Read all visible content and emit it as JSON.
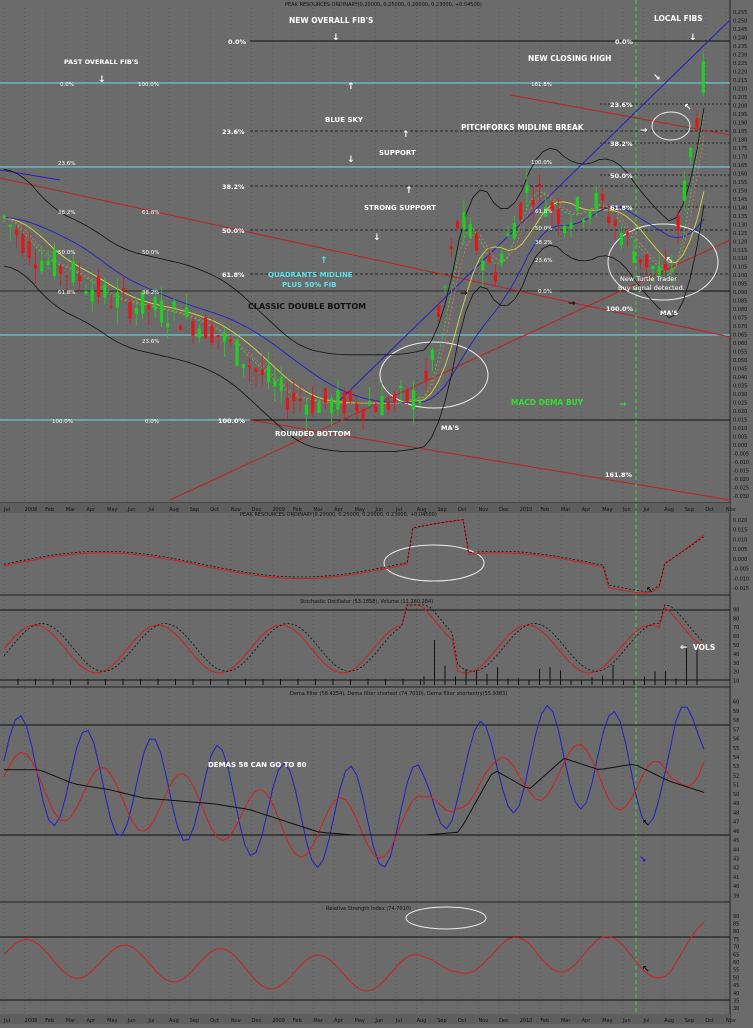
{
  "main_header": "PEAK RESOURCES ORDINARY(0.20000, 0.25000, 0.20000, 0.23000, +0.04500)",
  "panel_headers": {
    "macd": "PEAK RESOURCES ORDINARY(0.20000, 0.25000, 0.20000, 0.23000, +0.04500)",
    "stochastic": "Stochastic Oscillator (53.1858), Volume (11,260,284)",
    "dema": "Dema filter (58.4254), Dema filter shortest (74.7010), Dema filter shortentry(55.9383)",
    "rsi": "Relative Strength Index (74.7010)"
  },
  "colors": {
    "background": "#6b6b6b",
    "grid": "#4f4f4f",
    "red_line": "#d02020",
    "blue_line": "#2020c8",
    "yellow_line": "#d8d840",
    "black_line": "#101010",
    "green_candle": "#20d020",
    "red_candle": "#e01818",
    "cyan": "#60e0e8",
    "signal_green": "#30e030",
    "annot_white": "#ffffff"
  },
  "annotations": {
    "new_overall_fibs": "NEW OVERALL FIB'S",
    "local_fibs": "LOCAL FIBS",
    "past_overall_fibs": "PAST OVERALL FIB'S",
    "new_closing_high": "NEW CLOSING HIGH",
    "blue_sky": "BLUE SKY",
    "pitchforks_midline_break": "PITCHFORKS MIDLINE BREAK",
    "support": "SUPPORT",
    "strong_support": "STRONG SUPPORT",
    "quadrants_midline": "QUADRANTS MIDLINE",
    "plus_50_fib": "PLUS 50% FIB",
    "classic_double_bottom": "CLASSIC DOUBLE BOTTOM",
    "rounded_bottom": "ROUNDED BOTTOM",
    "mas_left": "MA'S",
    "mas_right": "MA'S",
    "macd_dema_buy": "MACD DEMA BUY",
    "turtle_trader_1": "New Turtle Trader",
    "turtle_trader_2": "Buy signal detected.",
    "vols": "VOLS",
    "demas": "DEMAS 58 CAN GO TO 80"
  },
  "fib_labels": {
    "new_0": "0.0%",
    "new_236": "23.6%",
    "new_382": "38.2%",
    "new_50": "50.0%",
    "new_618": "61.8%",
    "new_100": "100.0%",
    "local_0": "0.0%",
    "local_236": "23.6%",
    "local_382": "38.2%",
    "local_50": "50.0%",
    "local_618": "61.8%",
    "local_100": "100.0%",
    "past_0": "0.0%",
    "past_100": "100.0%",
    "past_236": "23.6%",
    "past_382": "38.2%",
    "past_50": "50.0%",
    "past_618": "61.8%",
    "past_236_b": "23.6%",
    "past_100_b": "100.0%",
    "q_618": "61.8%",
    "q_50": "50.0%",
    "q_382": "38.2%",
    "q_0": "0.0%",
    "s_1618": "161.8%",
    "s_100": "100.0%",
    "s_618": "61.8%",
    "s_50": "50.0%",
    "s_382": "38.2%",
    "s_236": "23.6%",
    "s_0": "0.0%",
    "bottom_1618": "161.8%"
  },
  "chart_data": [
    {
      "type": "line",
      "panel": "price",
      "title": "PEAK RESOURCES ORDINARY",
      "last_ohlc": {
        "open": 0.2,
        "high": 0.25,
        "low": 0.2,
        "close": 0.23,
        "change": 0.045
      },
      "ylim": [
        -0.035,
        0.27
      ],
      "y_ticks": [
        "0.255",
        "0.250",
        "0.245",
        "0.240",
        "0.235",
        "0.230",
        "0.225",
        "0.220",
        "0.215",
        "0.210",
        "0.205",
        "0.200",
        "0.195",
        "0.190",
        "0.185",
        "0.180",
        "0.175",
        "0.170",
        "0.165",
        "0.160",
        "0.155",
        "0.150",
        "0.145",
        "0.140",
        "0.135",
        "0.130",
        "0.125",
        "0.120",
        "0.115",
        "0.110",
        "0.105",
        "0.100",
        "0.095",
        "0.090",
        "0.085",
        "0.080",
        "0.075",
        "0.070",
        "0.065",
        "0.060",
        "0.055",
        "0.050",
        "0.045",
        "0.040",
        "0.035",
        "0.030",
        "0.025",
        "0.020",
        "0.015",
        "0.010",
        "0.005",
        "0.000",
        "-0.005",
        "-0.010",
        "-0.015",
        "-0.020",
        "-0.025",
        "-0.030"
      ],
      "series": [
        {
          "name": "close",
          "x": [
            0,
            5,
            10,
            15,
            20,
            25,
            30,
            35,
            40,
            45,
            50,
            55,
            60,
            65,
            70,
            75,
            80,
            85,
            90,
            95,
            100
          ],
          "values": [
            0.14,
            0.115,
            0.105,
            0.09,
            0.085,
            0.08,
            0.07,
            0.05,
            0.03,
            0.025,
            0.025,
            0.025,
            0.03,
            0.14,
            0.105,
            0.16,
            0.14,
            0.15,
            0.12,
            0.1,
            0.23
          ]
        }
      ]
    },
    {
      "type": "line",
      "panel": "macd",
      "ylim": [
        -0.016,
        0.024
      ],
      "y_ticks": [
        "0.020",
        "0.015",
        "0.010",
        "0.005",
        "0.000",
        "-0.005",
        "-0.010",
        "-0.015"
      ]
    },
    {
      "type": "line",
      "panel": "stochastic",
      "ylim": [
        0,
        95
      ],
      "y_ticks": [
        "90",
        "80",
        "70",
        "60",
        "50",
        "40",
        "30",
        "20",
        "10"
      ],
      "series": [
        {
          "name": "Stochastic Oscillator",
          "last": 53.1858
        },
        {
          "name": "Volume",
          "last": 11260284
        }
      ]
    },
    {
      "type": "line",
      "panel": "dema",
      "ylim": [
        38,
        61
      ],
      "y_ticks": [
        "60",
        "59",
        "58",
        "57",
        "56",
        "55",
        "54",
        "53",
        "52",
        "51",
        "50",
        "49",
        "48",
        "47",
        "46",
        "45",
        "44",
        "43",
        "42",
        "41",
        "40",
        "39"
      ],
      "series": [
        {
          "name": "Dema filter",
          "last": 58.4254
        },
        {
          "name": "Dema filter shortest",
          "last": 74.701
        },
        {
          "name": "Dema filter shortentry",
          "last": 55.9383
        }
      ]
    },
    {
      "type": "line",
      "panel": "rsi",
      "ylim": [
        26,
        94
      ],
      "y_ticks": [
        "90",
        "85",
        "80",
        "75",
        "70",
        "65",
        "60",
        "55",
        "50",
        "45",
        "40",
        "35",
        "30"
      ],
      "series": [
        {
          "name": "Relative Strength Index",
          "last": 74.701
        }
      ]
    }
  ],
  "x_axis": {
    "top_months": [
      "Jul",
      "2008",
      "Feb",
      "Mar",
      "Apr",
      "May",
      "Jun",
      "Jul",
      "Aug",
      "Sep",
      "Oct",
      "Nov",
      "Dec",
      "2009",
      "Feb",
      "Mar",
      "Apr",
      "May",
      "Jun",
      "Jul",
      "Aug",
      "Sep",
      "Oct",
      "Nov",
      "Dec",
      "2010",
      "Feb",
      "Mar",
      "Apr",
      "May",
      "Jun",
      "Jul",
      "Aug",
      "Sep",
      "Oct",
      "Nov"
    ],
    "bottom_months": [
      "Jul",
      "2008",
      "Feb",
      "Mar",
      "Apr",
      "May",
      "Jun",
      "Jul",
      "Aug",
      "Sep",
      "Oct",
      "Nov",
      "Dec",
      "2009",
      "Feb",
      "Mar",
      "Apr",
      "May",
      "Jun",
      "Jul",
      "Aug",
      "Sep",
      "Oct",
      "Nov",
      "Dec",
      "2010",
      "Feb",
      "Mar",
      "Apr",
      "May",
      "Jun",
      "Jul",
      "Aug",
      "Sep",
      "Oct",
      "Nov"
    ]
  }
}
